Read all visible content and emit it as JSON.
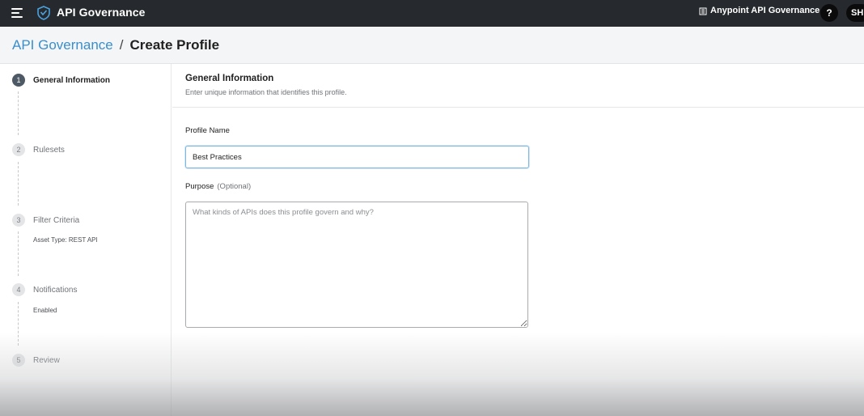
{
  "topbar": {
    "brand_title": "API Governance",
    "app_switcher_label": "Anypoint API Governance",
    "help_label": "?",
    "avatar_initials": "SH"
  },
  "breadcrumb": {
    "parent": "API Governance",
    "separator": "/",
    "current": "Create Profile"
  },
  "steps": [
    {
      "number": "1",
      "label": "General Information",
      "active": true
    },
    {
      "number": "2",
      "label": "Rulesets",
      "active": false
    },
    {
      "number": "3",
      "label": "Filter Criteria",
      "active": false,
      "sub": "Asset Type: REST API"
    },
    {
      "number": "4",
      "label": "Notifications",
      "active": false,
      "sub": "Enabled"
    },
    {
      "number": "5",
      "label": "Review",
      "active": false
    }
  ],
  "section": {
    "title": "General Information",
    "description": "Enter unique information that identifies this profile."
  },
  "form": {
    "profile_name_label": "Profile Name",
    "profile_name_value": "Best Practices",
    "purpose_label": "Purpose",
    "purpose_optional": "(Optional)",
    "purpose_placeholder": "What kinds of APIs does this profile govern and why?"
  },
  "colors": {
    "topbar_bg": "#262a2e",
    "link": "#3a8ecb",
    "active_step": "#4d5a66",
    "input_focus": "#7fb6e0"
  }
}
